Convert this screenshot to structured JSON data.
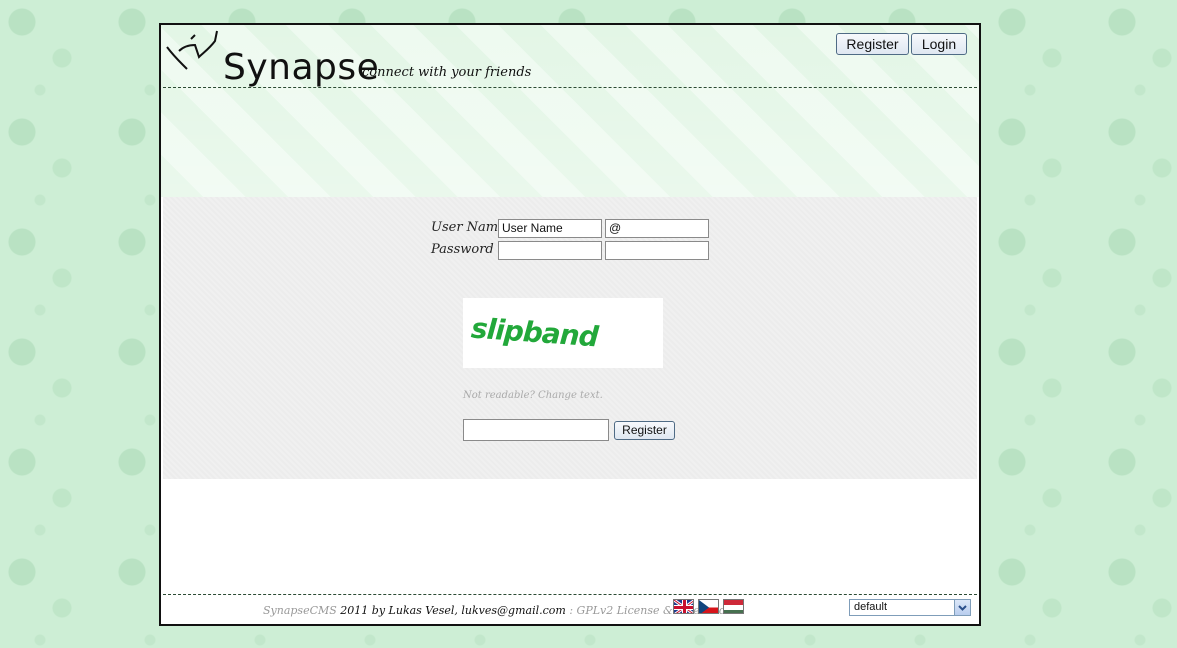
{
  "header": {
    "logo_text": "Synapse",
    "slogan": "connect with your friends",
    "register_button": "Register",
    "login_button": "Login"
  },
  "form": {
    "user_name_label": "User Name",
    "password_label": "Password",
    "user_name_value": "User Name",
    "domain_value": "@",
    "password_value": "",
    "password_confirm_value": "",
    "captcha_text": "slipband",
    "captcha_change": "Not readable? Change text.",
    "captcha_input_value": "",
    "register_button": "Register"
  },
  "footer": {
    "app_name": "SynapseCMS",
    "copyright": " 2011 by Lukas Vesel, lukves@gmail.com",
    "separator": " : ",
    "license": "GPLv2 License & Licensed",
    "languages": [
      "en-flag-icon",
      "cz-flag-icon",
      "hu-flag-icon"
    ],
    "skin_selected": "default"
  },
  "colors": {
    "background": "#cdeed5",
    "header": "#e8f8ea",
    "captcha": "#22a83a",
    "button_border": "#4f6b85"
  }
}
